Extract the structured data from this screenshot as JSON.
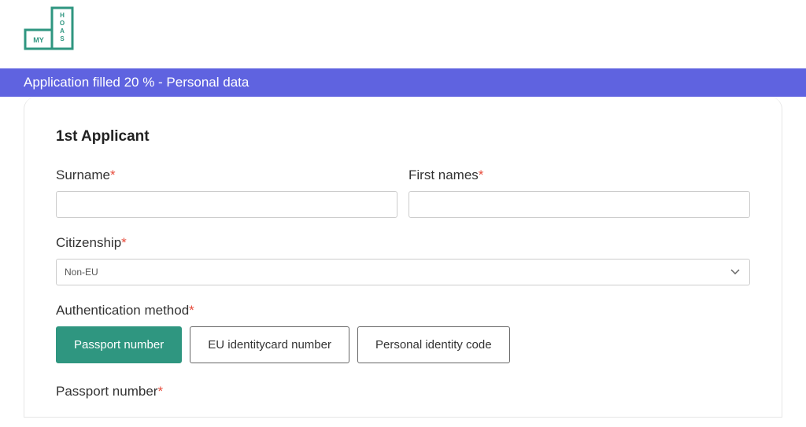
{
  "logo": {
    "text_my": "MY",
    "text_hoas": "HOAS"
  },
  "progress": {
    "text": "Application filled 20 % - Personal data"
  },
  "form": {
    "section_title": "1st Applicant",
    "surname": {
      "label": "Surname",
      "value": ""
    },
    "firstnames": {
      "label": "First names",
      "value": ""
    },
    "citizenship": {
      "label": "Citizenship",
      "selected": "Non-EU"
    },
    "auth_method": {
      "label": "Authentication method",
      "options": {
        "passport": "Passport number",
        "eu_id": "EU identitycard number",
        "pic": "Personal identity code"
      }
    },
    "passport_number": {
      "label": "Passport number"
    }
  }
}
